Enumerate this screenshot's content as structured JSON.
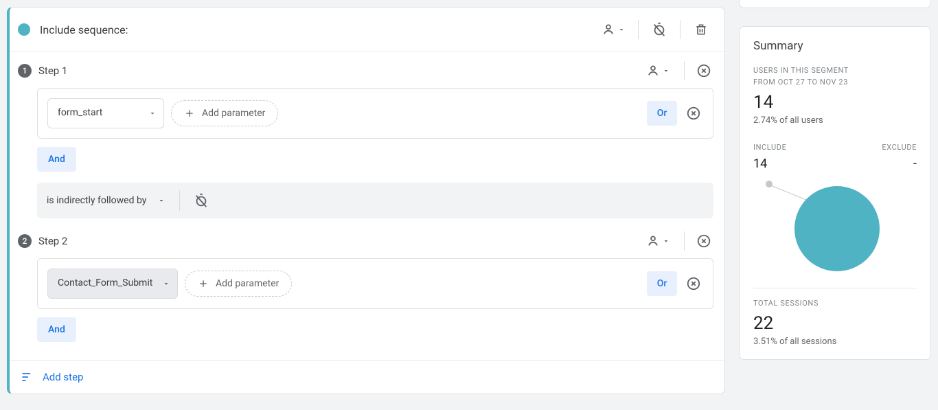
{
  "sequence": {
    "title": "Include sequence:",
    "add_step_label": "Add step",
    "steps": [
      {
        "num": "1",
        "label": "Step 1",
        "event": "form_start",
        "add_param": "Add parameter",
        "or": "Or",
        "and": "And"
      },
      {
        "num": "2",
        "label": "Step 2",
        "event": "Contact_Form_Submit",
        "add_param": "Add parameter",
        "or": "Or",
        "and": "And"
      }
    ],
    "follow_label": "is indirectly followed by"
  },
  "summary": {
    "title": "Summary",
    "kicker_line1": "USERS IN THIS SEGMENT",
    "kicker_line2": "FROM OCT 27 TO NOV 23",
    "users_value": "14",
    "users_pct": "2.74% of all users",
    "include_label": "INCLUDE",
    "exclude_label": "EXCLUDE",
    "include_value": "14",
    "exclude_value": "-",
    "sessions_label": "TOTAL SESSIONS",
    "sessions_value": "22",
    "sessions_pct": "3.51% of all sessions"
  }
}
